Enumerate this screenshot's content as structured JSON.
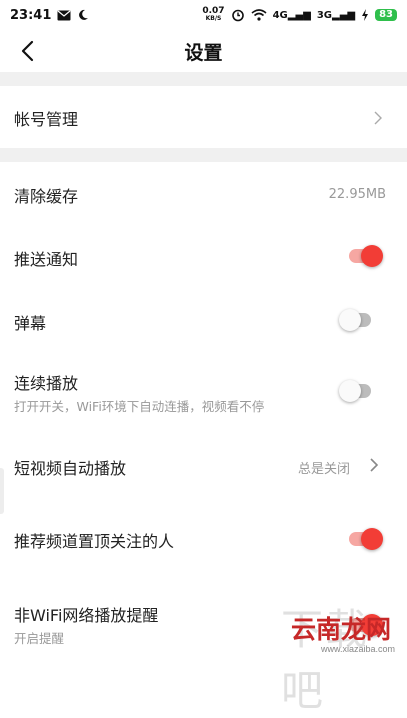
{
  "status_bar": {
    "time": "23:41",
    "speed_value": "0.07",
    "speed_unit": "KB/S",
    "network1": "4G",
    "network2": "3G",
    "battery": "83"
  },
  "header": {
    "title": "设置"
  },
  "settings": {
    "account": {
      "label": "帐号管理"
    },
    "clear_cache": {
      "label": "清除缓存",
      "value": "22.95MB"
    },
    "push": {
      "label": "推送通知",
      "enabled": true
    },
    "danmaku": {
      "label": "弹幕",
      "enabled": false
    },
    "autoplay": {
      "label": "连续播放",
      "description": "打开开关，WiFi环境下自动连播，视频看不停",
      "enabled": false
    },
    "short_video": {
      "label": "短视频自动播放",
      "value": "总是关闭"
    },
    "pin_follow": {
      "label": "推荐频道置顶关注的人",
      "enabled": true
    },
    "non_wifi": {
      "label": "非WiFi网络播放提醒",
      "description": "开启提醒",
      "enabled": true
    }
  },
  "watermark": {
    "text": "云南龙网",
    "url": "www.xiazaiba.com"
  },
  "colors": {
    "accent": "#f23d36",
    "separator": "#f0f0f0",
    "muted_text": "#999999"
  }
}
